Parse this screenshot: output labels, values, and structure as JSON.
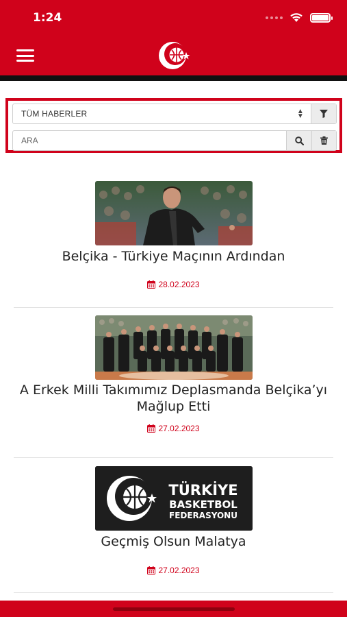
{
  "status_bar": {
    "time": "1:24"
  },
  "app": {
    "logo_icon": "tbf-basketball-crescent-logo"
  },
  "filters": {
    "category_value": "TÜM HABERLER",
    "search_placeholder": "ARA"
  },
  "news": [
    {
      "title": "Belçika - Türkiye Maçının Ardından",
      "date": "28.02.2023",
      "image": "coach-photo"
    },
    {
      "title": "A Erkek Milli Takımımız Deplasmanda Belçika’yı Mağlup Etti",
      "date": "27.02.2023",
      "image": "team-photo"
    },
    {
      "title": "Geçmiş Olsun Malatya",
      "date": "27.02.2023",
      "image": "federation-logo",
      "logo_lines": [
        "TÜRKİYE",
        "BASKETBOL",
        "FEDERASYONU"
      ]
    }
  ],
  "colors": {
    "brand_red": "#d0021b",
    "dark_bar": "#111111"
  }
}
